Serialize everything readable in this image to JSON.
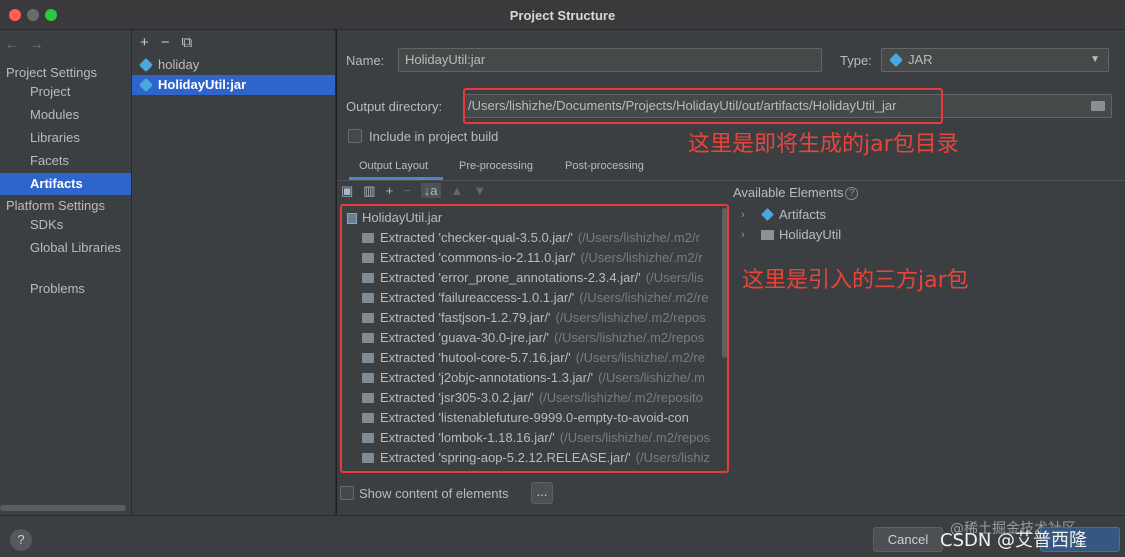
{
  "window": {
    "title": "Project Structure"
  },
  "sidebar": {
    "nav_back": "←",
    "nav_forward": "→",
    "project_settings_header": "Project Settings",
    "project_items": [
      "Project",
      "Modules",
      "Libraries",
      "Facets",
      "Artifacts"
    ],
    "platform_settings_header": "Platform Settings",
    "platform_items": [
      "SDKs",
      "Global Libraries"
    ],
    "problems": "Problems"
  },
  "artifact_list": {
    "toolbar": {
      "add": "+",
      "remove": "−",
      "copy": "⧉"
    },
    "items": [
      "holiday",
      "HolidayUtil:jar"
    ]
  },
  "form": {
    "name_label": "Name:",
    "name_value": "HolidayUtil:jar",
    "type_label": "Type:",
    "type_value": "JAR",
    "output_dir_label": "Output directory:",
    "output_dir_value": "/Users/lishizhe/Documents/Projects/HolidayUtil/out/artifacts/HolidayUtil_jar",
    "include_in_build_label": "Include in project build"
  },
  "tabs": [
    "Output Layout",
    "Pre-processing",
    "Post-processing"
  ],
  "layout_toolbar": {
    "new_dir": "▣",
    "archive": "▥",
    "add": "+",
    "remove": "−",
    "sort": "↓a",
    "up": "▲",
    "down": "▼"
  },
  "output_tree": {
    "root": "HolidayUtil.jar",
    "items": [
      {
        "name": "Extracted 'checker-qual-3.5.0.jar/'",
        "path": "(/Users/lishizhe/.m2/r"
      },
      {
        "name": "Extracted 'commons-io-2.11.0.jar/'",
        "path": "(/Users/lishizhe/.m2/r"
      },
      {
        "name": "Extracted 'error_prone_annotations-2.3.4.jar/'",
        "path": "(/Users/lis"
      },
      {
        "name": "Extracted 'failureaccess-1.0.1.jar/'",
        "path": "(/Users/lishizhe/.m2/re"
      },
      {
        "name": "Extracted 'fastjson-1.2.79.jar/'",
        "path": "(/Users/lishizhe/.m2/repos"
      },
      {
        "name": "Extracted 'guava-30.0-jre.jar/'",
        "path": "(/Users/lishizhe/.m2/repos"
      },
      {
        "name": "Extracted 'hutool-core-5.7.16.jar/'",
        "path": "(/Users/lishizhe/.m2/re"
      },
      {
        "name": "Extracted 'j2objc-annotations-1.3.jar/'",
        "path": "(/Users/lishizhe/.m"
      },
      {
        "name": "Extracted 'jsr305-3.0.2.jar/'",
        "path": "(/Users/lishizhe/.m2/reposito"
      },
      {
        "name": "Extracted 'listenablefuture-9999.0-empty-to-avoid-con",
        "path": ""
      },
      {
        "name": "Extracted 'lombok-1.18.16.jar/'",
        "path": "(/Users/lishizhe/.m2/repos"
      },
      {
        "name": "Extracted 'spring-aop-5.2.12.RELEASE.jar/'",
        "path": "(/Users/lishiz"
      }
    ]
  },
  "available_elements": {
    "header": "Available Elements",
    "help": "?",
    "items": [
      "Artifacts",
      "HolidayUtil"
    ]
  },
  "annotations": {
    "output_dir_note": "这里是即将生成的jar包目录",
    "deps_note": "这里是引入的三方jar包"
  },
  "show_content": {
    "label": "Show content of elements",
    "more_button": "..."
  },
  "bottom": {
    "help": "?",
    "cancel": "Cancel",
    "watermark": "CSDN @艾普西隆",
    "watermark_bg": "@稀土掘金技术社区"
  }
}
